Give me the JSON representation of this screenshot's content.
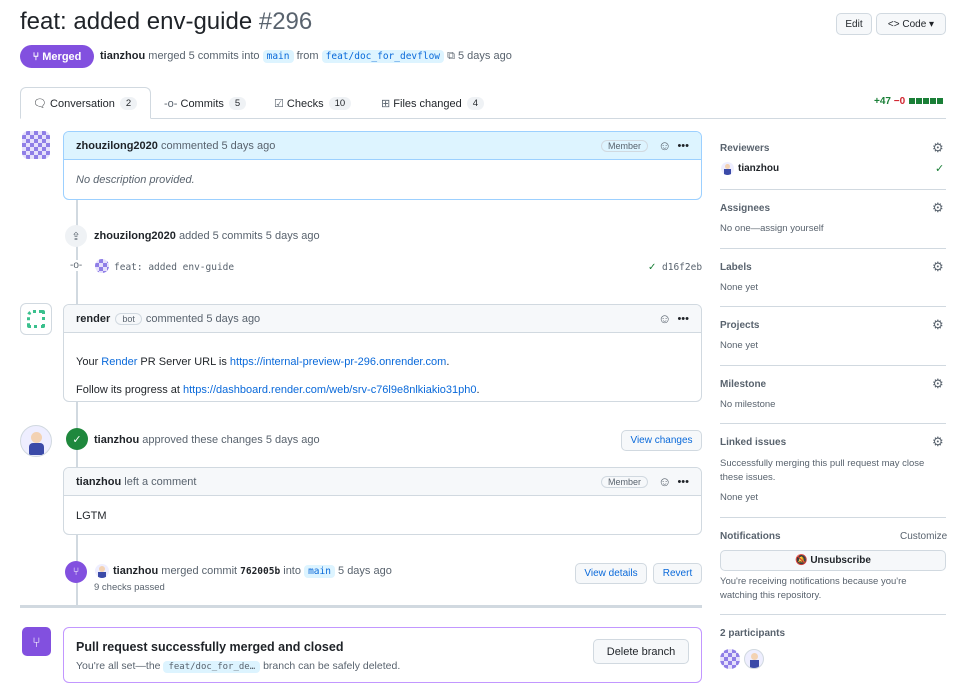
{
  "header": {
    "title": "feat: added env-guide",
    "number": "#296",
    "edit": "Edit",
    "code": "Code",
    "state": "Merged",
    "author": "tianzhou",
    "merge_text": "merged 5 commits into",
    "base": "main",
    "from": "from",
    "head": "feat/doc_for_devflow",
    "time": "5 days ago"
  },
  "tabs": [
    {
      "label": "Conversation",
      "count": "2"
    },
    {
      "label": "Commits",
      "count": "5"
    },
    {
      "label": "Checks",
      "count": "10"
    },
    {
      "label": "Files changed",
      "count": "4"
    }
  ],
  "diffstat": {
    "add": "+47",
    "del": "−0",
    "blocks": 5
  },
  "timeline": {
    "c1": {
      "author": "zhouzilong2020",
      "action": "commented 5 days ago",
      "badge": "Member",
      "body": "No description provided."
    },
    "push": {
      "author": "zhouzilong2020",
      "action": "added 5 commits 5 days ago",
      "commit_msg": "feat: added env-guide",
      "sha": "d16f2eb"
    },
    "c2": {
      "author": "render",
      "bot": "bot",
      "action": "commented 5 days ago",
      "l1_pre": "Your ",
      "l1_link": "Render",
      "l1_mid": " PR Server URL is ",
      "l1_url": "https://internal-preview-pr-296.onrender.com",
      "l1_end": ".",
      "l2_pre": "Follow its progress at ",
      "l2_url": "https://dashboard.render.com/web/srv-c76l9e8nlkiakio31ph0",
      "l2_end": "."
    },
    "review": {
      "author": "tianzhou",
      "action": "approved these changes 5 days ago",
      "button": "View changes"
    },
    "c3": {
      "author": "tianzhou",
      "action": "left a comment",
      "badge": "Member",
      "body": "LGTM"
    },
    "merge": {
      "author": "tianzhou",
      "action": "merged commit",
      "sha": "762005b",
      "into": "into",
      "base": "main",
      "time": "5 days ago",
      "checks": "9 checks passed",
      "details": "View details",
      "revert": "Revert"
    },
    "closed": {
      "title": "Pull request successfully merged and closed",
      "pre": "You're all set—the",
      "branch": "feat/doc_for_de…",
      "post": "branch can be safely deleted.",
      "button": "Delete branch"
    }
  },
  "sidebar": {
    "reviewers": {
      "label": "Reviewers",
      "value": "tianzhou"
    },
    "assignees": {
      "label": "Assignees",
      "value": "No one—assign yourself"
    },
    "labels": {
      "label": "Labels",
      "value": "None yet"
    },
    "projects": {
      "label": "Projects",
      "value": "None yet"
    },
    "milestone": {
      "label": "Milestone",
      "value": "No milestone"
    },
    "linked": {
      "label": "Linked issues",
      "desc": "Successfully merging this pull request may close these issues.",
      "value": "None yet"
    },
    "notifications": {
      "label": "Notifications",
      "customize": "Customize",
      "button": "Unsubscribe",
      "desc": "You're receiving notifications because you're watching this repository."
    },
    "participants": {
      "label": "2 participants"
    }
  },
  "colors": {
    "merged": "#8250df",
    "link": "#0969da",
    "success": "#1a7f37",
    "danger": "#d1242f",
    "comment_header": "#ddf4ff"
  }
}
